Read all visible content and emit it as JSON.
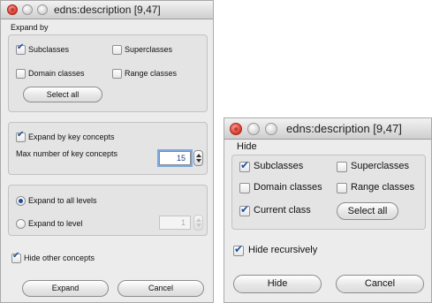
{
  "expand_dialog": {
    "title": "edns:description [9,47]",
    "expand_by": {
      "label": "Expand by",
      "subclasses": {
        "label": "Subclasses",
        "checked": true
      },
      "superclasses": {
        "label": "Superclasses",
        "checked": false
      },
      "domain_classes": {
        "label": "Domain classes",
        "checked": false
      },
      "range_classes": {
        "label": "Range classes",
        "checked": false
      },
      "select_all": "Select all"
    },
    "key_concepts": {
      "expand_by_key_concepts": {
        "label": "Expand by key concepts",
        "checked": true
      },
      "max_label": "Max number of key concepts",
      "max_value": "15"
    },
    "levels": {
      "all_levels": {
        "label": "Expand to all levels",
        "selected": true
      },
      "to_level": {
        "label": "Expand to level",
        "selected": false
      },
      "level_value": "1"
    },
    "hide_other": {
      "label": "Hide other concepts",
      "checked": true
    },
    "buttons": {
      "expand": "Expand",
      "cancel": "Cancel"
    }
  },
  "hide_dialog": {
    "title": "edns:description [9,47]",
    "hide": {
      "label": "Hide",
      "subclasses": {
        "label": "Subclasses",
        "checked": true
      },
      "superclasses": {
        "label": "Superclasses",
        "checked": false
      },
      "domain_classes": {
        "label": "Domain classes",
        "checked": false
      },
      "range_classes": {
        "label": "Range classes",
        "checked": false
      },
      "current_class": {
        "label": "Current class",
        "checked": true
      },
      "select_all": "Select all"
    },
    "hide_recursively": {
      "label": "Hide recursively",
      "checked": true
    },
    "buttons": {
      "hide": "Hide",
      "cancel": "Cancel"
    }
  }
}
